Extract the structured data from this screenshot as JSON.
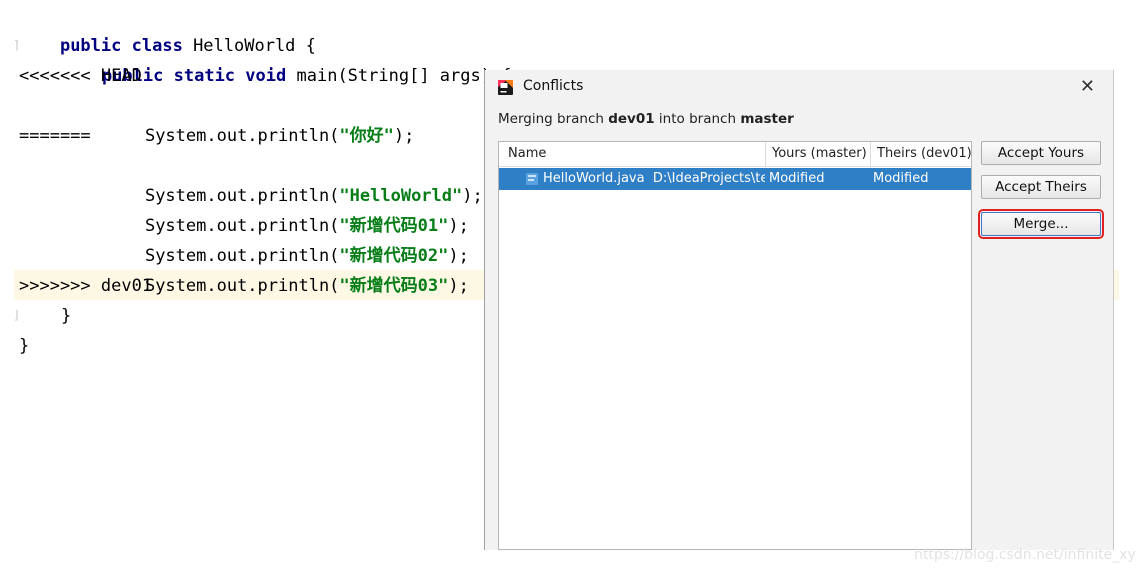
{
  "editor": {
    "lines": [
      "public class HelloWorld {",
      "    public static void main(String[] args) {",
      "<<<<<<< HEAD",
      "        System.out.println(\"你好\");",
      "=======",
      "        System.out.println(\"HelloWorld\");",
      "        System.out.println(\"新增代码01\");",
      "        System.out.println(\"新增代码02\");",
      "        System.out.println(\"新增代码03\");",
      ">>>>>>> dev01",
      "    }",
      "}"
    ],
    "tokens": {
      "public": "public",
      "class": "class",
      "class_name": "HelloWorld {",
      "static": "static",
      "void": "void",
      "main_sig": "main(String[] args) {",
      "head_marker": "<<<<<<< HEAD",
      "separator": "=======",
      "dev_marker": ">>>>>>> dev01",
      "println": "System.out.println(",
      "end": ");",
      "str_nihao": "\"你好\"",
      "str_hello": "\"HelloWorld\"",
      "str_01": "\"新增代码01\"",
      "str_02": "\"新增代码02\"",
      "str_03": "\"新增代码03\"",
      "close_inner": "}",
      "close_outer": "}"
    }
  },
  "dialog": {
    "title": "Conflicts",
    "close_glyph": "✕",
    "message_prefix": "Merging branch ",
    "message_branch_from": "dev01",
    "message_mid": " into branch ",
    "message_branch_to": "master",
    "table": {
      "columns": [
        "Name",
        "Yours (master)",
        "Theirs (dev01)"
      ],
      "rows": [
        {
          "file": "HelloWorld.java",
          "path": "D:\\IdeaProjects\\te",
          "yours": "Modified",
          "theirs": "Modified"
        }
      ]
    },
    "buttons": {
      "accept_yours": "Accept Yours",
      "accept_theirs": "Accept Theirs",
      "merge": "Merge..."
    }
  },
  "watermark": "https://blog.csdn.net/infinite_xy",
  "colors": {
    "selection": "#2f7fc6",
    "keyword": "#000080",
    "string": "#067d17",
    "highlight_line": "#fdf8e4",
    "merge_outline": "#e02020"
  }
}
